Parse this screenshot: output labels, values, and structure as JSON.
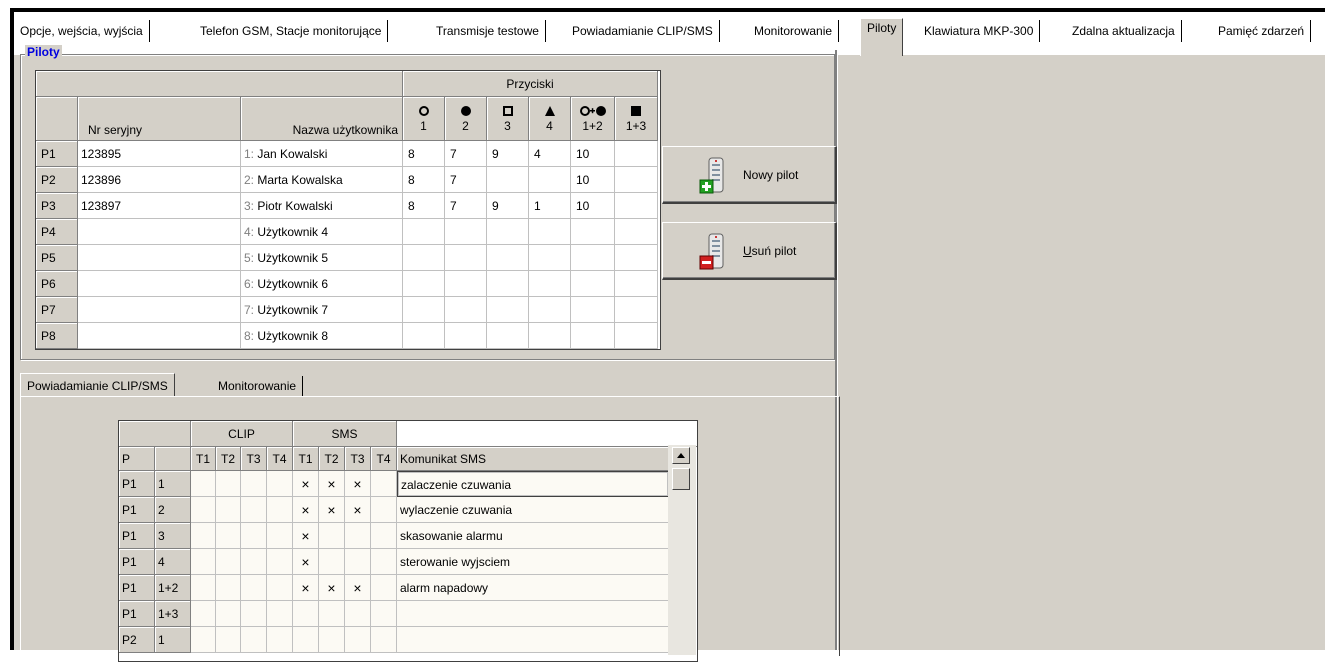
{
  "top_tabs": [
    {
      "label": "Opcje, wejścia, wyjścia",
      "active": false
    },
    {
      "label": "Telefon GSM, Stacje monitorujące",
      "active": false
    },
    {
      "label": "Transmisje testowe",
      "active": false
    },
    {
      "label": "Powiadamianie CLIP/SMS",
      "active": false
    },
    {
      "label": "Monitorowanie",
      "active": false
    },
    {
      "label": "Piloty",
      "active": true
    },
    {
      "label": "Klawiatura MKP-300",
      "active": false
    },
    {
      "label": "Zdalna aktualizacja",
      "active": false
    },
    {
      "label": "Pamięć zdarzeń",
      "active": false
    }
  ],
  "group_title": "Piloty",
  "pilots_table": {
    "buttons_group_label": "Przyciski",
    "col_serial": "Nr seryjny",
    "col_user": "Nazwa użytkownika",
    "button_cols": [
      {
        "icon": "circle-outline-icon",
        "label": "1"
      },
      {
        "icon": "circle-filled-icon",
        "label": "2"
      },
      {
        "icon": "square-outline-icon",
        "label": "3"
      },
      {
        "icon": "triangle-filled-icon",
        "label": "4"
      },
      {
        "icon": "circle-outline-plus-filled-icon",
        "label": "1+2"
      },
      {
        "icon": "square-filled-icon",
        "label": "1+3"
      }
    ],
    "rows": [
      {
        "id": "P1",
        "serial": "123895",
        "num": "1:",
        "user": "Jan Kowalski",
        "b": [
          "8",
          "7",
          "9",
          "4",
          "10",
          ""
        ]
      },
      {
        "id": "P2",
        "serial": "123896",
        "num": "2:",
        "user": "Marta Kowalska",
        "b": [
          "8",
          "7",
          "",
          "",
          "10",
          ""
        ]
      },
      {
        "id": "P3",
        "serial": "123897",
        "num": "3:",
        "user": "Piotr Kowalski",
        "b": [
          "8",
          "7",
          "9",
          "1",
          "10",
          ""
        ]
      },
      {
        "id": "P4",
        "serial": "",
        "num": "4:",
        "user": "Użytkownik 4",
        "b": [
          "",
          "",
          "",
          "",
          "",
          ""
        ]
      },
      {
        "id": "P5",
        "serial": "",
        "num": "5:",
        "user": "Użytkownik 5",
        "b": [
          "",
          "",
          "",
          "",
          "",
          ""
        ]
      },
      {
        "id": "P6",
        "serial": "",
        "num": "6:",
        "user": "Użytkownik 6",
        "b": [
          "",
          "",
          "",
          "",
          "",
          ""
        ]
      },
      {
        "id": "P7",
        "serial": "",
        "num": "7:",
        "user": "Użytkownik 7",
        "b": [
          "",
          "",
          "",
          "",
          "",
          ""
        ]
      },
      {
        "id": "P8",
        "serial": "",
        "num": "8:",
        "user": "Użytkownik 8",
        "b": [
          "",
          "",
          "",
          "",
          "",
          ""
        ]
      }
    ]
  },
  "buttons": {
    "new_pilot": "Nowy pilot",
    "delete_pilot": "Usuń pilot"
  },
  "sub_tabs": [
    {
      "label": "Powiadamianie CLIP/SMS",
      "active": true
    },
    {
      "label": "Monitorowanie",
      "active": false
    }
  ],
  "clip_sms_table": {
    "group_clip": "CLIP",
    "group_sms": "SMS",
    "col_p": "P",
    "col_msg": "Komunikat SMS",
    "t_labels": [
      "T1",
      "T2",
      "T3",
      "T4"
    ],
    "mark": "×",
    "rows": [
      {
        "p": "P1",
        "btn": "1",
        "clip": [
          false,
          false,
          false,
          false
        ],
        "sms": [
          true,
          true,
          true,
          false
        ],
        "msg": "zalaczenie czuwania"
      },
      {
        "p": "P1",
        "btn": "2",
        "clip": [
          false,
          false,
          false,
          false
        ],
        "sms": [
          true,
          true,
          true,
          false
        ],
        "msg": "wylaczenie czuwania"
      },
      {
        "p": "P1",
        "btn": "3",
        "clip": [
          false,
          false,
          false,
          false
        ],
        "sms": [
          true,
          false,
          false,
          false
        ],
        "msg": "skasowanie alarmu"
      },
      {
        "p": "P1",
        "btn": "4",
        "clip": [
          false,
          false,
          false,
          false
        ],
        "sms": [
          true,
          false,
          false,
          false
        ],
        "msg": "sterowanie wyjsciem"
      },
      {
        "p": "P1",
        "btn": "1+2",
        "clip": [
          false,
          false,
          false,
          false
        ],
        "sms": [
          true,
          true,
          true,
          false
        ],
        "msg": "alarm napadowy"
      },
      {
        "p": "P1",
        "btn": "1+3",
        "clip": [
          false,
          false,
          false,
          false
        ],
        "sms": [
          false,
          false,
          false,
          false
        ],
        "msg": ""
      },
      {
        "p": "P2",
        "btn": "1",
        "clip": [
          false,
          false,
          false,
          false
        ],
        "sms": [
          false,
          false,
          false,
          false
        ],
        "msg": ""
      }
    ]
  }
}
